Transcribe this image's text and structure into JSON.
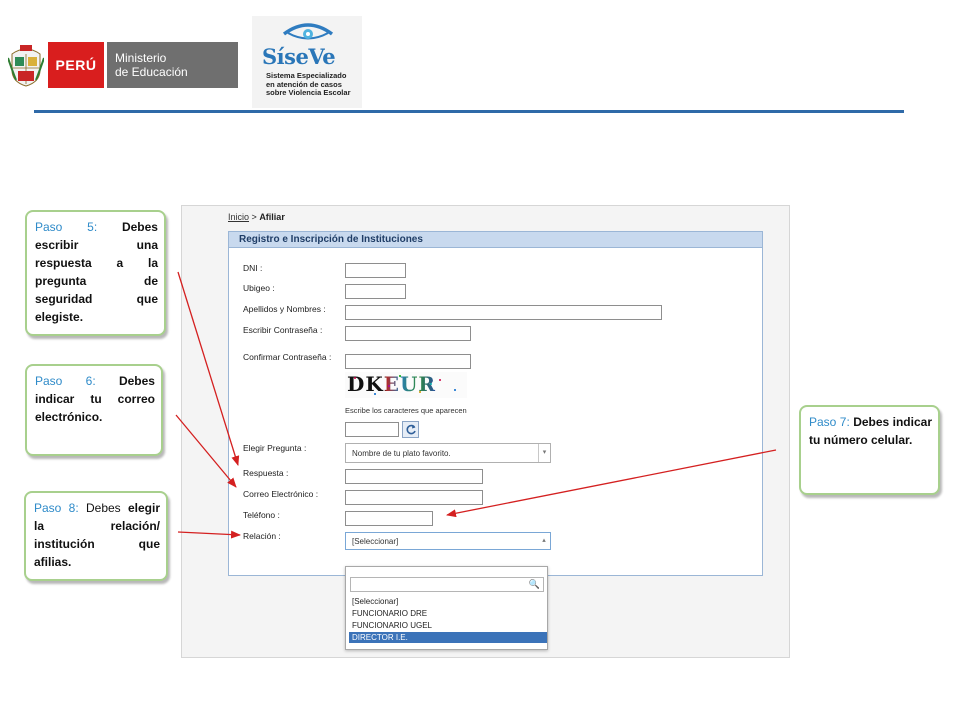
{
  "header": {
    "peru_word": "PERÚ",
    "ministry_line1": "Ministerio",
    "ministry_line2": "de Educación",
    "siseve_name": "SíseVe",
    "siseve_sub_line1": "Sistema Especializado",
    "siseve_sub_line2": "en atención de casos",
    "siseve_sub_line3": "sobre Violencia Escolar"
  },
  "screenshot": {
    "breadcrumb_home": "Inicio",
    "breadcrumb_sep": ">",
    "breadcrumb_current": "Afiliar",
    "form_title": "Registro e Inscripción de Instituciones",
    "labels": {
      "dni": "DNI :",
      "ubigeo": "Ubigeo :",
      "nombres": "Apellidos y Nombres :",
      "contrasena": "Escribir Contraseña :",
      "confirmar": "Confirmar Contraseña :",
      "pregunta": "Elegir Pregunta :",
      "respuesta": "Respuesta :",
      "correo": "Correo Electrónico :",
      "telefono": "Teléfono :",
      "relacion": "Relación :"
    },
    "captcha_text": "DKEUR",
    "captcha_hint": "Escribe los caracteres que aparecen",
    "pregunta_value": "Nombre de tu plato favorito.",
    "relacion_value": "[Seleccionar]",
    "dropdown_options": [
      "[Seleccionar]",
      "FUNCIONARIO DRE",
      "FUNCIONARIO UGEL",
      "DIRECTOR I.E."
    ],
    "selected_option_index": 3
  },
  "callouts": {
    "paso5": {
      "step": "Paso 5:",
      "text": "Debes escribir una respuesta a la pregunta de seguridad que elegiste."
    },
    "paso6": {
      "step": "Paso 6:",
      "text": "Debes indicar tu correo electrónico."
    },
    "paso7": {
      "step": "Paso 7:",
      "text": "Debes indicar tu número celular."
    },
    "paso8": {
      "step": "Paso 8:",
      "text_plain": "Debes",
      "text_bold": "elegir la relación/ institución que afilias."
    }
  },
  "colors": {
    "peru_red": "#d91e1e",
    "ministry_grey": "#6f6f6f",
    "header_line": "#2f6aa8",
    "step_blue": "#2f8bc9",
    "callout_border": "#a8d08d",
    "arrow_red": "#d42020",
    "selected_option": "#3b73b9"
  }
}
